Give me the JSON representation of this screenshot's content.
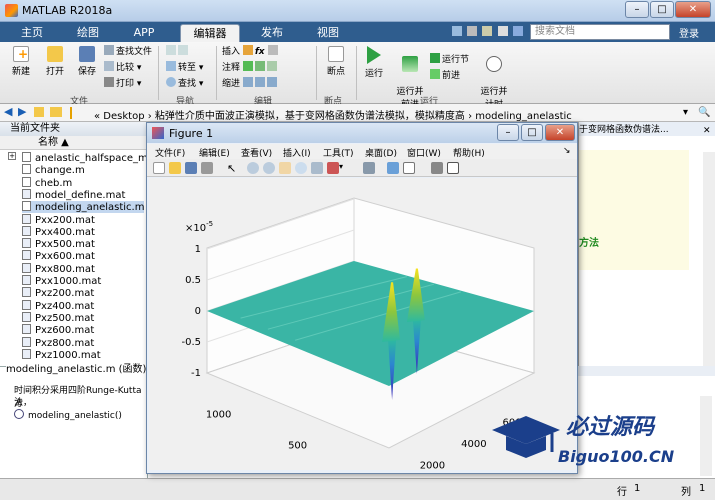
{
  "window": {
    "title": "MATLAB R2018a",
    "min": "–",
    "max": "□",
    "close": "✕"
  },
  "tabs": [
    "主页",
    "绘图",
    "APP",
    "编辑器",
    "发布",
    "视图"
  ],
  "search": {
    "placeholder": "搜索文档"
  },
  "login": "登录",
  "ribbon": {
    "file": {
      "new": "新建",
      "open": "打开",
      "save": "保存",
      "find_files": "查找文件",
      "compare": "比较",
      "print": "打印",
      "group": "文件"
    },
    "nav": {
      "goto": "转至",
      "find": "查找",
      "group": "导航"
    },
    "edit": {
      "insert": "插入",
      "comment": "注释",
      "indent": "缩进",
      "group": "编辑"
    },
    "breakpoints": {
      "label": "断点",
      "group": "断点"
    },
    "run": {
      "run": "运行",
      "run_advance": "运行并\n前进",
      "run_section": "运行节",
      "advance": "前进",
      "run_time": "运行并\n计时",
      "group": "运行"
    }
  },
  "address": {
    "path": "«  Desktop  ›  粘弹性介质中面波正演模拟，基于变网格函数伪谱法模拟，模拟精度高  ›  modeling_anelastic"
  },
  "files": {
    "panel_title": "当前文件夹",
    "column": "名称 ▲",
    "items": [
      "anelastic_halfspace_mo...",
      "change.m",
      "cheb.m",
      "model_define.mat",
      "modeling_anelastic.m",
      "Pxx200.mat",
      "Pxx400.mat",
      "Pxx500.mat",
      "Pxx600.mat",
      "Pxx800.mat",
      "Pxx1000.mat",
      "Pxz200.mat",
      "Pxz400.mat",
      "Pxz500.mat",
      "Pxz600.mat",
      "Pxz800.mat",
      "Pxz1000.mat"
    ]
  },
  "details": {
    "header": "modeling_anelastic.m  (函数)",
    "desc1": "时间积分采用四阶Runge-Kutta方",
    "desc2": "法，",
    "func": "modeling_anelastic()"
  },
  "editor": {
    "title_frag": "于变网格函数伪谱法...",
    "code_frag": "方法"
  },
  "status": {
    "row_label": "行",
    "row": "1",
    "col_label": "列",
    "col": "1"
  },
  "figure": {
    "title": "Figure 1",
    "menu": [
      "文件(F)",
      "编辑(E)",
      "查看(V)",
      "插入(I)",
      "工具(T)",
      "桌面(D)",
      "窗口(W)",
      "帮助(H)"
    ],
    "scale": "×10",
    "scale_exp": "-5",
    "z_ticks": [
      "1",
      "0.5",
      "0",
      "-0.5",
      "-1"
    ],
    "y_ticks": [
      "1000",
      "500",
      "0"
    ],
    "x_ticks": [
      "2000",
      "4000",
      "6000"
    ]
  },
  "chart_data": {
    "type": "surface",
    "title": "",
    "xlabel": "",
    "ylabel": "",
    "zlabel": "",
    "zlim": [
      -1e-05,
      1e-05
    ],
    "z_scale_label": "×10^-5",
    "x_ticks": [
      2000,
      4000,
      6000
    ],
    "y_ticks": [
      0,
      500,
      1000
    ],
    "z_ticks": [
      -1,
      -0.5,
      0,
      0.5,
      1
    ],
    "peaks": [
      {
        "x": 2700,
        "y": 350,
        "z_max": 0.9,
        "z_min": -1.0
      },
      {
        "x": 4400,
        "y": 420,
        "z_max": 0.8,
        "z_min": -0.9
      }
    ],
    "colormap": "parula"
  },
  "watermark": {
    "cn": "必过源码",
    "en": "Biguo100.CN"
  },
  "colors": {
    "tab_bg": "#2f5d8e",
    "surface": "#3ab5a5",
    "peak": "#f2e024",
    "trough": "#3b2fc2"
  }
}
